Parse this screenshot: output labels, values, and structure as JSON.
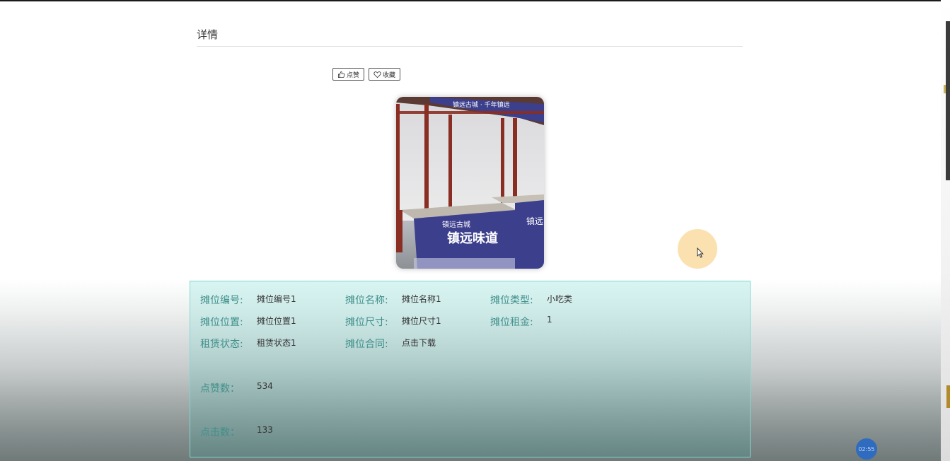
{
  "page": {
    "title": "详情"
  },
  "actions": {
    "like_label": "点赞",
    "favorite_label": "收藏"
  },
  "details": {
    "stall_number_label": "摊位编号:",
    "stall_number_value": "摊位编号1",
    "stall_name_label": "摊位名称:",
    "stall_name_value": "摊位名称1",
    "stall_type_label": "摊位类型:",
    "stall_type_value": "小吃类",
    "stall_location_label": "摊位位置:",
    "stall_location_value": "摊位位置1",
    "stall_size_label": "摊位尺寸:",
    "stall_size_value": "摊位尺寸1",
    "stall_rent_label": "摊位租金:",
    "stall_rent_value": "1",
    "lease_status_label": "租赁状态:",
    "lease_status_value": "租赁状态1",
    "contract_label": "摊位合同:",
    "contract_value": "点击下载",
    "likes_label": "点赞数：",
    "likes_value": "534",
    "clicks_label": "点击数：",
    "clicks_value": "133"
  },
  "photo": {
    "sign_top": "镇远古城 · 千年镇远",
    "sign_small": "镇远古城",
    "sign_main": "镇远味道",
    "sign_side": "镇远"
  },
  "overlay": {
    "timer": "02:55"
  },
  "colors": {
    "label": "#3f8f8a",
    "panel_border": "#7fd8d2",
    "banner_blue": "#3c3f8c",
    "stall_frame": "#8a2d22"
  }
}
